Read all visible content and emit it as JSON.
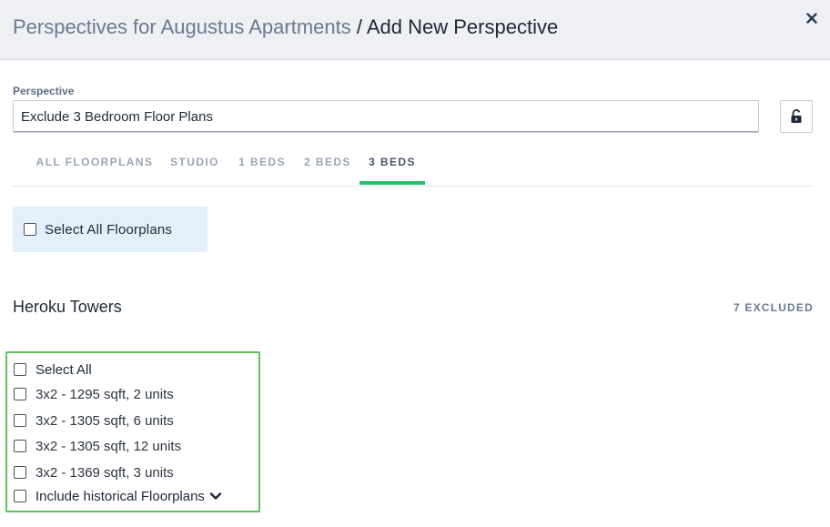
{
  "header": {
    "breadcrumb": "Perspectives for Augustus Apartments",
    "separator": " / ",
    "title": "Add New Perspective",
    "close_icon": "close-icon"
  },
  "form": {
    "label": "Perspective",
    "value": "Exclude 3 Bedroom Floor Plans",
    "lock_icon": "unlock-icon"
  },
  "tabs": [
    {
      "label": "ALL FLOORPLANS",
      "active": false
    },
    {
      "label": "STUDIO",
      "active": false
    },
    {
      "label": "1 BEDS",
      "active": false
    },
    {
      "label": "2 BEDS",
      "active": false
    },
    {
      "label": "3 BEDS",
      "active": true
    }
  ],
  "select_all_floorplans": {
    "label": "Select All Floorplans",
    "checked": false
  },
  "property": {
    "name": "Heroku Towers",
    "excluded": "7 EXCLUDED",
    "select_all": {
      "label": "Select All",
      "checked": false
    },
    "floorplans": [
      {
        "label": "3x2 - 1295 sqft, 2 units",
        "checked": false
      },
      {
        "label": "3x2 - 1305 sqft, 6 units",
        "checked": false
      },
      {
        "label": "3x2 - 1305 sqft, 12 units",
        "checked": false
      },
      {
        "label": "3x2 - 1369 sqft, 3 units",
        "checked": false
      }
    ],
    "historical": {
      "label": "Include historical Floorplans",
      "checked": false,
      "icon": "chevron-down-icon"
    }
  },
  "colors": {
    "accent_tab": "#23c06a",
    "highlight_border": "#5cc15a",
    "select_all_bg": "#e3f0fb",
    "header_bg": "#eef0f3"
  }
}
